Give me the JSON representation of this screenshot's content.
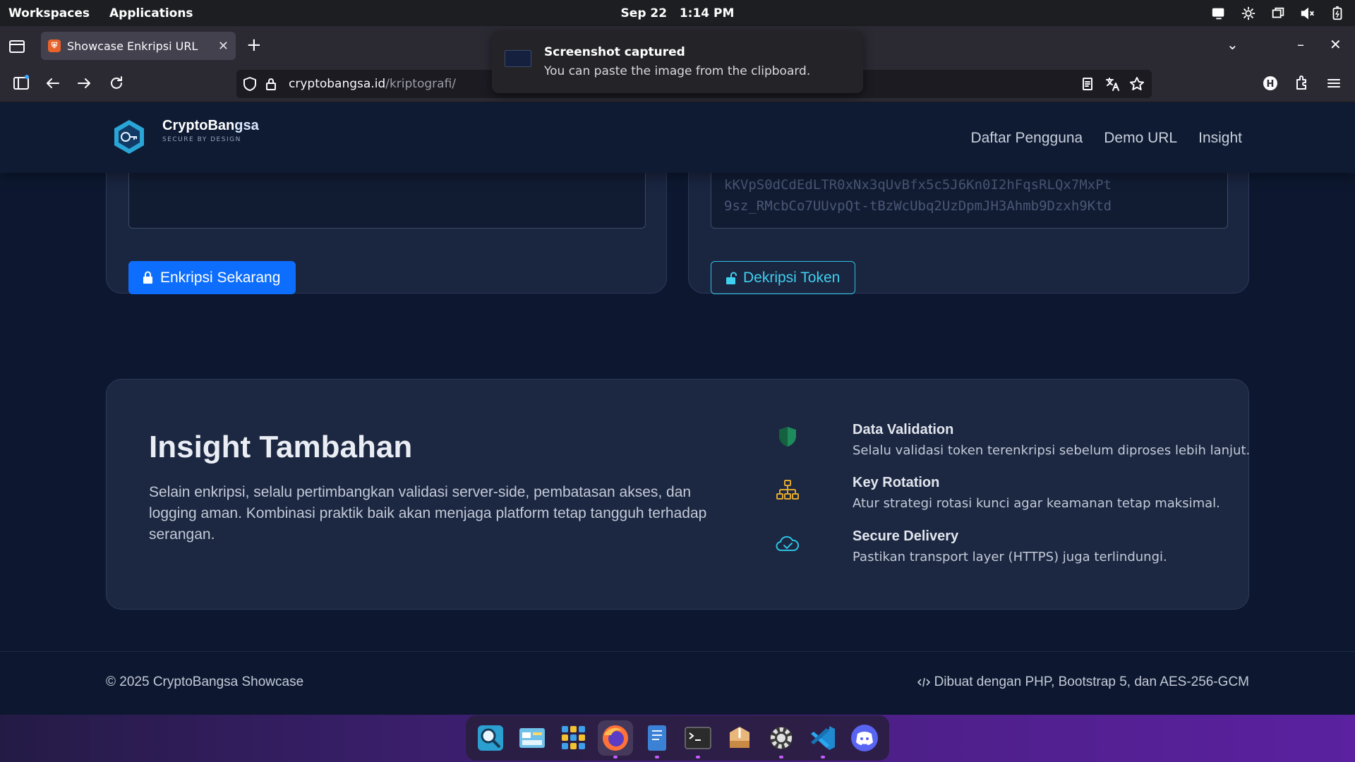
{
  "topbar": {
    "workspaces": "Workspaces",
    "applications": "Applications",
    "date": "Sep 22",
    "time": "1:14 PM",
    "tray_icons": [
      "display-icon",
      "gear-icon",
      "window-icon",
      "volume-muted-icon",
      "battery-icon"
    ]
  },
  "browser": {
    "tab_title": "Showcase Enkripsi URL",
    "tab_close": "✕",
    "new_tab": "+",
    "url_domain": "cryptobangsa.id",
    "url_path": "/kriptografi/"
  },
  "notification": {
    "title": "Screenshot captured",
    "body": "You can paste the image from the clipboard."
  },
  "site": {
    "brand_name_a": "CryptoBan",
    "brand_name_b": "gsa",
    "brand_tag": "SECURE BY DESIGN",
    "nav": [
      "Daftar Pengguna",
      "Demo URL",
      "Insight"
    ],
    "encrypt_button": "Enkripsi Sekarang",
    "decrypt_button": "Dekripsi Token",
    "token_preview_line1": "kKVpS0dCdEdLTR0xNx3qUvBfx5c5J6Kn0I2hFqsRLQx7MxPt",
    "token_preview_line2": "9sz_RMcbCo7UUvpQt-tBzWcUbq2UzDpmJH3Ahmb9Dzxh9Ktd"
  },
  "insight": {
    "title": "Insight Tambahan",
    "description": "Selain enkripsi, selalu pertimbangkan validasi server-side, pembatasan akses, dan logging aman. Kombinasi praktik baik akan menjaga platform tetap tangguh terhadap serangan.",
    "features": [
      {
        "title": "Data Validation",
        "desc": "Selalu validasi token terenkripsi sebelum diproses lebih lanjut.",
        "icon": "shield-icon",
        "color": "#1f8a5c"
      },
      {
        "title": "Key Rotation",
        "desc": "Atur strategi rotasi kunci agar keamanan tetap maksimal.",
        "icon": "hierarchy-icon",
        "color": "#e0a82e"
      },
      {
        "title": "Secure Delivery",
        "desc": "Pastikan transport layer (HTTPS) juga terlindungi.",
        "icon": "cloud-check-icon",
        "color": "#2ec3e4"
      }
    ]
  },
  "footer": {
    "copyright": "© 2025 CryptoBangsa Showcase",
    "built_with": "Dibuat dengan PHP, Bootstrap 5, dan AES-256-GCM"
  },
  "dock": [
    "search-app-icon",
    "files-app-icon",
    "app-grid-icon",
    "firefox-icon",
    "text-editor-icon",
    "terminal-icon",
    "archive-app-icon",
    "settings-app-icon",
    "vscode-icon",
    "discord-icon"
  ]
}
